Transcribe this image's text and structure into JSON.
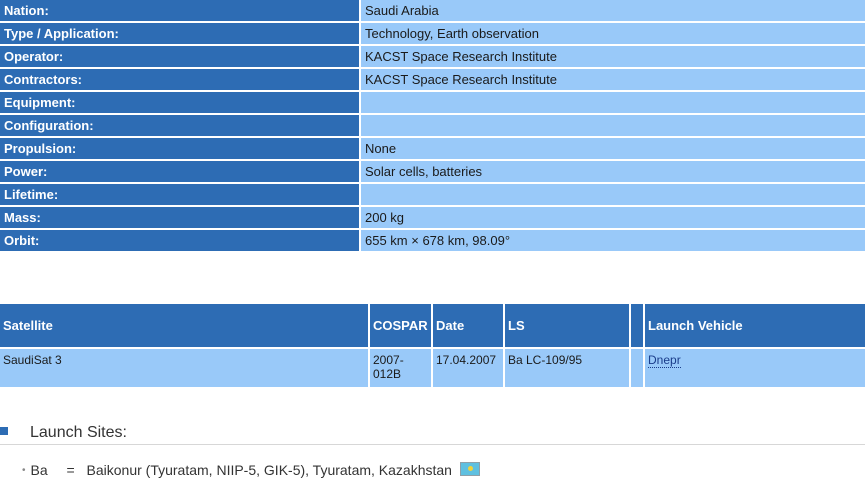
{
  "properties": [
    {
      "label": "Nation:",
      "value": "Saudi Arabia"
    },
    {
      "label": "Type / Application:",
      "value": "Technology, Earth observation"
    },
    {
      "label": "Operator:",
      "value": "KACST Space Research Institute"
    },
    {
      "label": "Contractors:",
      "value": "KACST Space Research Institute"
    },
    {
      "label": "Equipment:",
      "value": ""
    },
    {
      "label": "Configuration:",
      "value": ""
    },
    {
      "label": "Propulsion:",
      "value": "None"
    },
    {
      "label": "Power:",
      "value": "Solar cells, batteries"
    },
    {
      "label": "Lifetime:",
      "value": ""
    },
    {
      "label": "Mass:",
      "value": "200 kg"
    },
    {
      "label": "Orbit:",
      "value": "655 km × 678 km, 98.09°"
    }
  ],
  "launch_table": {
    "headers": {
      "satellite": "Satellite",
      "cospar": "COSPAR",
      "date": "Date",
      "ls": "LS",
      "extra": "",
      "vehicle": "Launch Vehicle"
    },
    "rows": [
      {
        "satellite": "SaudiSat 3",
        "cospar": "2007-012B",
        "date": "17.04.2007",
        "ls": "Ba LC-109/95",
        "extra": "",
        "vehicle": "Dnepr"
      }
    ]
  },
  "launch_sites": {
    "title": "Launch Sites:",
    "items": [
      {
        "code": "Ba",
        "eq": "=",
        "name": "Baikonur (Tyuratam, NIIP-5, GIK-5), Tyuratam, Kazakhstan",
        "flag_icon": "kazakhstan-flag-icon"
      }
    ]
  }
}
